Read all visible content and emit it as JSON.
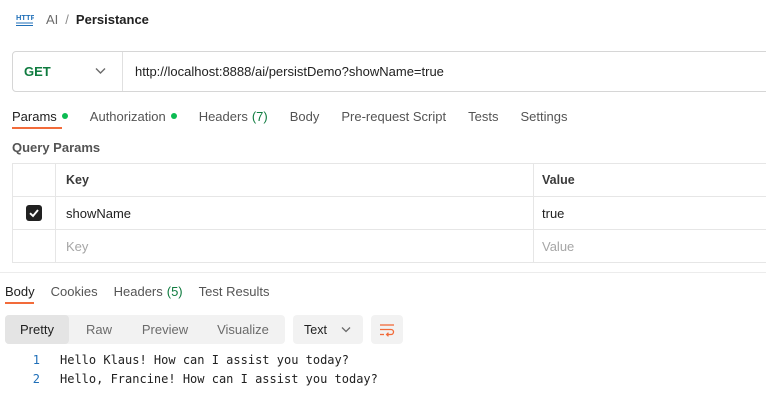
{
  "breadcrumb": {
    "parent": "AI",
    "separator": "/",
    "title": "Persistance",
    "icon": "http-icon"
  },
  "request": {
    "method": "GET",
    "url": "http://localhost:8888/ai/persistDemo?showName=true"
  },
  "request_tabs": [
    {
      "label": "Params",
      "dot": true
    },
    {
      "label": "Authorization",
      "dot": true
    },
    {
      "label": "Headers",
      "count": "(7)"
    },
    {
      "label": "Body"
    },
    {
      "label": "Pre-request Script"
    },
    {
      "label": "Tests"
    },
    {
      "label": "Settings"
    }
  ],
  "query_params": {
    "title": "Query Params",
    "columns": {
      "key": "Key",
      "value": "Value"
    },
    "rows": [
      {
        "key": "showName",
        "value": "true",
        "checked": true
      }
    ],
    "placeholder": {
      "key": "Key",
      "value": "Value"
    }
  },
  "response_tabs": [
    {
      "label": "Body"
    },
    {
      "label": "Cookies"
    },
    {
      "label": "Headers",
      "count": "(5)"
    },
    {
      "label": "Test Results"
    }
  ],
  "view_options": [
    "Pretty",
    "Raw",
    "Preview",
    "Visualize"
  ],
  "format": "Text",
  "response_lines": [
    {
      "n": "1",
      "text": "Hello Klaus! How can I assist you today?"
    },
    {
      "n": "2",
      "text": "Hello, Francine! How can I assist you today?"
    }
  ],
  "colors": {
    "accent": "#f26b3a",
    "get_method": "#0f7b3f",
    "status_dot": "#0cbb52",
    "line_numbers": "#1f6fb8"
  }
}
